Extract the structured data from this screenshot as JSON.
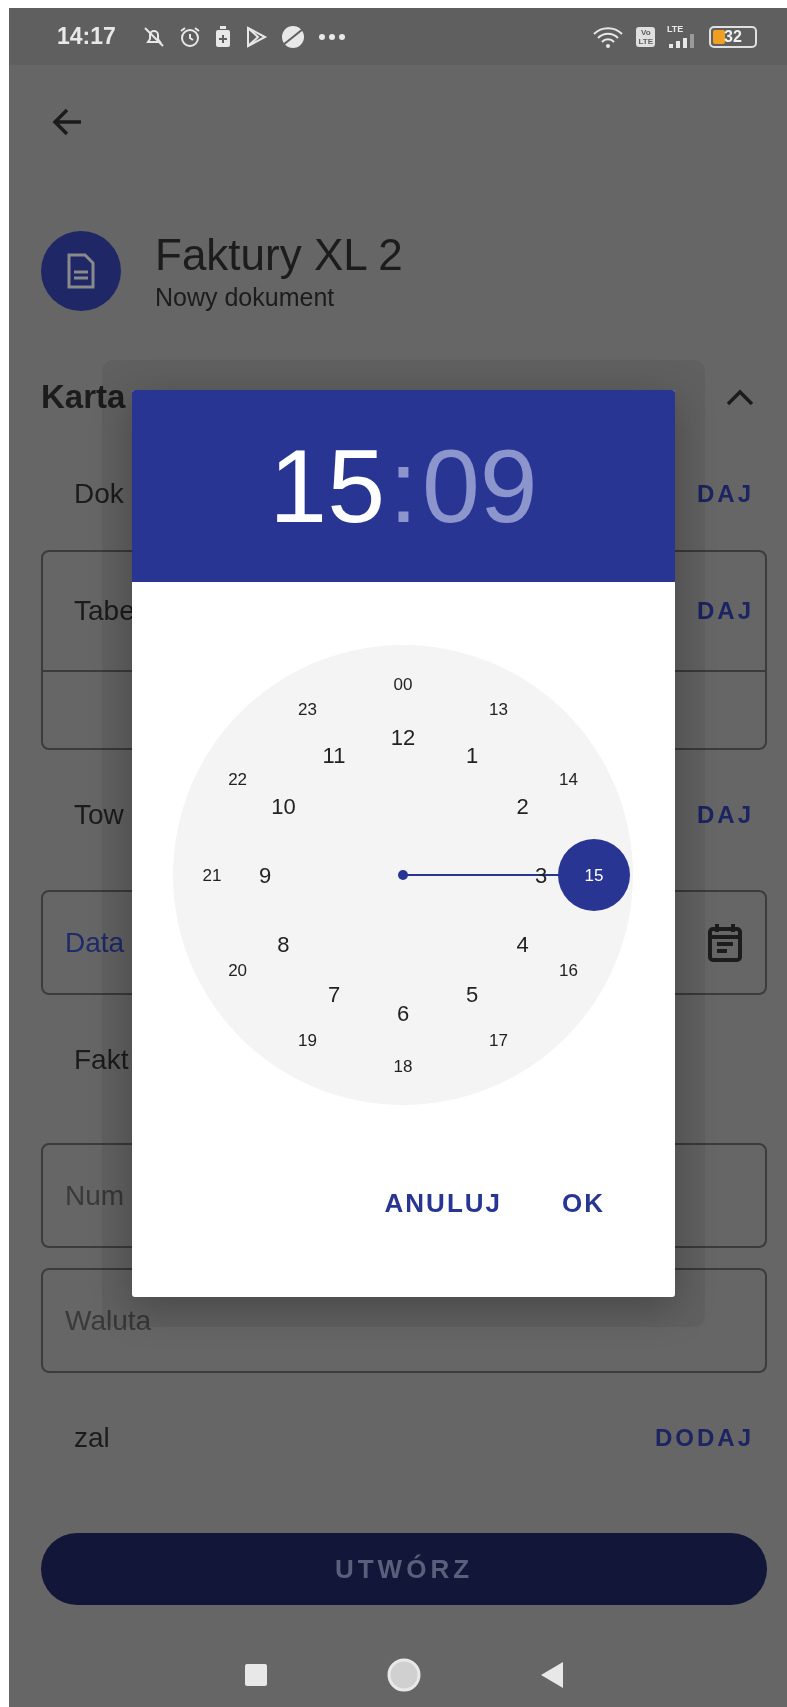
{
  "status_bar": {
    "time": "14:17",
    "volte_top": "Vo",
    "volte_bottom": "LTE",
    "network_type": "LTE",
    "battery": "32"
  },
  "header": {
    "title": "Faktury XL 2",
    "subtitle": "Nowy dokument"
  },
  "section": {
    "title": "Karta",
    "expanded": true
  },
  "rows": [
    {
      "kind": "row",
      "label": "Dok",
      "action": "DAJ"
    },
    {
      "kind": "group",
      "label": "Tabe",
      "action": "DAJ"
    },
    {
      "kind": "row",
      "label": "Tow",
      "action": "DAJ"
    },
    {
      "kind": "date",
      "label": "Data"
    },
    {
      "kind": "row",
      "label": "Fakt"
    },
    {
      "kind": "field",
      "placeholder": "Num"
    },
    {
      "kind": "field",
      "placeholder": "Waluta"
    },
    {
      "kind": "row",
      "label": "zal",
      "action": "DODAJ"
    }
  ],
  "primary_button": "UTWÓRZ",
  "dialog": {
    "hour": "15",
    "separator": ":",
    "minute": "09",
    "hour_selected": true,
    "outer": [
      {
        "label": "00",
        "selected": false
      },
      {
        "label": "13",
        "selected": false
      },
      {
        "label": "14",
        "selected": false
      },
      {
        "label": "15",
        "selected": true
      },
      {
        "label": "16",
        "selected": false
      },
      {
        "label": "17",
        "selected": false
      },
      {
        "label": "18",
        "selected": false
      },
      {
        "label": "19",
        "selected": false
      },
      {
        "label": "20",
        "selected": false
      },
      {
        "label": "21",
        "selected": false
      },
      {
        "label": "22",
        "selected": false
      },
      {
        "label": "23",
        "selected": false
      }
    ],
    "inner": [
      {
        "label": "12",
        "selected": false
      },
      {
        "label": "1",
        "selected": false
      },
      {
        "label": "2",
        "selected": false
      },
      {
        "label": "3",
        "selected": false
      },
      {
        "label": "4",
        "selected": false
      },
      {
        "label": "5",
        "selected": false
      },
      {
        "label": "6",
        "selected": false
      },
      {
        "label": "7",
        "selected": false
      },
      {
        "label": "8",
        "selected": false
      },
      {
        "label": "9",
        "selected": false
      },
      {
        "label": "10",
        "selected": false
      },
      {
        "label": "11",
        "selected": false
      }
    ],
    "buttons": [
      "ANULUJ",
      "OK"
    ]
  }
}
